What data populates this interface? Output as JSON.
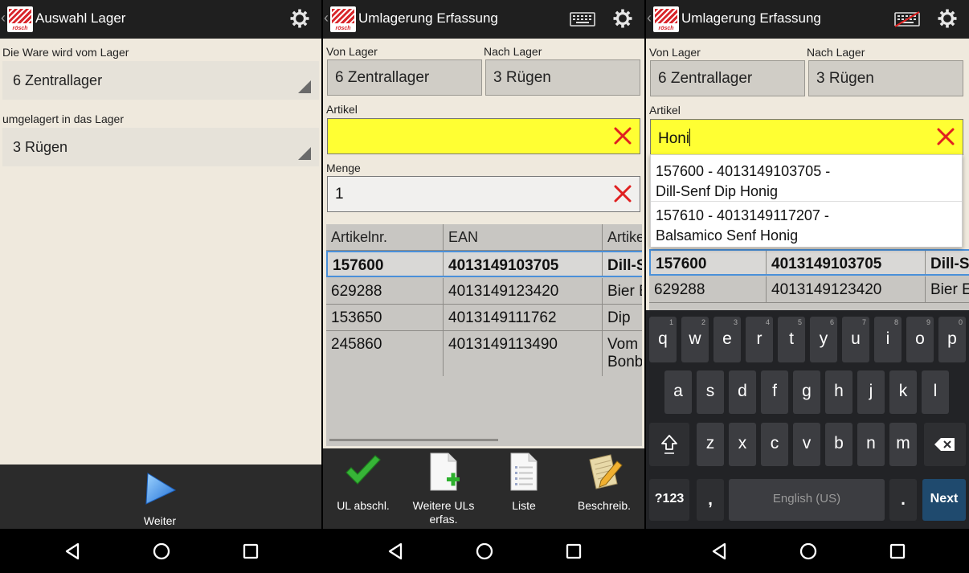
{
  "screen1": {
    "title": "Auswahl Lager",
    "from_label": "Die Ware wird vom Lager",
    "from_value": "6 Zentrallager",
    "to_label": "umgelagert in das Lager",
    "to_value": "3 Rügen",
    "next_label": "Weiter"
  },
  "screen2": {
    "title": "Umlagerung Erfassung",
    "von_label": "Von Lager",
    "von_value": "6 Zentrallager",
    "nach_label": "Nach Lager",
    "nach_value": "3 Rügen",
    "artikel_label": "Artikel",
    "artikel_value": "",
    "menge_label": "Menge",
    "menge_value": "1",
    "columns": [
      "Artikelnr.",
      "EAN",
      "Artikel"
    ],
    "rows": [
      [
        "157600",
        "4013149103705",
        "Dill-Senf"
      ],
      [
        "629288",
        "4013149123420",
        "Bier Bbq"
      ],
      [
        "153650",
        "4013149111762",
        "Dip"
      ],
      [
        "245860",
        "4013149113490",
        "Vom\nBonb"
      ]
    ],
    "buttons": [
      "UL abschl.",
      "Weitere ULs\nerfas.",
      "Liste",
      "Beschreib."
    ]
  },
  "screen3": {
    "title": "Umlagerung Erfassung",
    "von_label": "Von Lager",
    "von_value": "6 Zentrallager",
    "nach_label": "Nach Lager",
    "nach_value": "3 Rügen",
    "artikel_label": "Artikel",
    "artikel_value": "Honi",
    "suggestions": [
      {
        "line1": "157600 - 4013149103705 -",
        "line2": "Dill-Senf Dip Honig"
      },
      {
        "line1": "157610 - 4013149117207 -",
        "line2": "Balsamico Senf Honig"
      }
    ],
    "rows": [
      [
        "157600",
        "4013149103705",
        "Dill-S"
      ],
      [
        "629288",
        "4013149123420",
        "Bier E"
      ]
    ],
    "keyboard": {
      "row1": [
        "q",
        "w",
        "e",
        "r",
        "t",
        "y",
        "u",
        "i",
        "o",
        "p"
      ],
      "row1_hints": [
        "1",
        "2",
        "3",
        "4",
        "5",
        "6",
        "7",
        "8",
        "9",
        "0"
      ],
      "row2": [
        "a",
        "s",
        "d",
        "f",
        "g",
        "h",
        "j",
        "k",
        "l"
      ],
      "row3": [
        "z",
        "x",
        "c",
        "v",
        "b",
        "n",
        "m"
      ],
      "symbols_label": "?123",
      "comma": ",",
      "space_label": "English (US)",
      "period": ".",
      "next_label": "Next"
    }
  },
  "colors": {
    "actionbar": "#1f1f1f",
    "background": "#efe9dd",
    "artikel_field": "#ffff33",
    "clear_x": "#e02020",
    "selection_border": "#4a90d9",
    "next_key": "#1f4a6e"
  },
  "icons": {
    "app_logo": "roesch-logo-icon",
    "settings": "gear-icon",
    "keyboard": "keyboard-icon",
    "keyboard_off": "keyboard-off-icon",
    "clear": "clear-x-icon",
    "forward": "play-arrow-icon",
    "check": "checkmark-icon",
    "new_doc": "document-add-icon",
    "list": "list-document-icon",
    "edit": "edit-notes-icon",
    "nav_back": "nav-back-icon",
    "nav_home": "nav-home-icon",
    "nav_recents": "nav-recents-icon"
  }
}
